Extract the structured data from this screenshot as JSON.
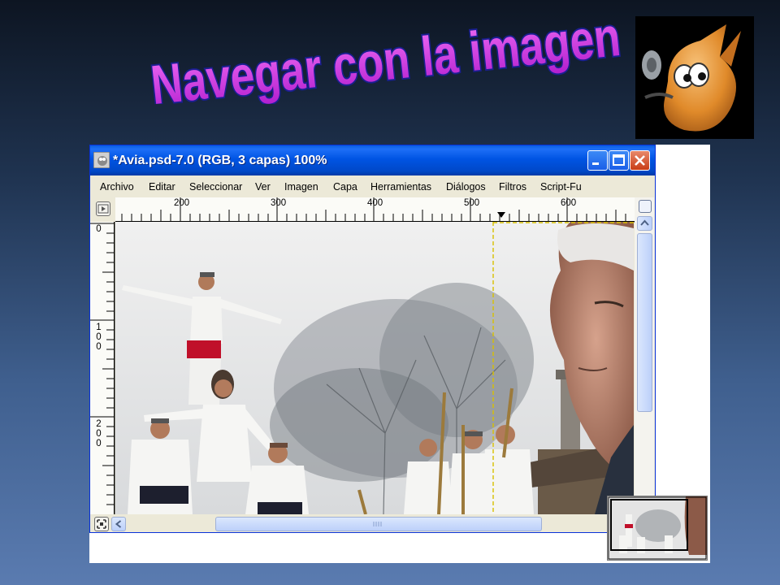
{
  "slide": {
    "title": "Navegar con la imagen"
  },
  "window": {
    "title": "*Avia.psd-7.0 (RGB, 3 capas) 100%"
  },
  "menu": {
    "items": [
      "Archivo",
      "Editar",
      "Seleccionar",
      "Ver",
      "Imagen",
      "Capa",
      "Herramientas",
      "Diálogos",
      "Filtros",
      "Script-Fu"
    ]
  },
  "ruler": {
    "top_labels": [
      "200",
      "300",
      "400",
      "500",
      "600"
    ],
    "left_labels": [
      "0",
      "100",
      "200"
    ]
  },
  "colors": {
    "title_fill": "#d63fe0",
    "title_outline": "#1a1f8f",
    "titlebar": "#0054e3",
    "selection_guide": "#d8c000"
  },
  "icons": {
    "logo": "gimp-wilber-icon",
    "app": "gimp-icon",
    "quick_mask": "quick-mask-icon",
    "navigate": "navigate-icon"
  }
}
